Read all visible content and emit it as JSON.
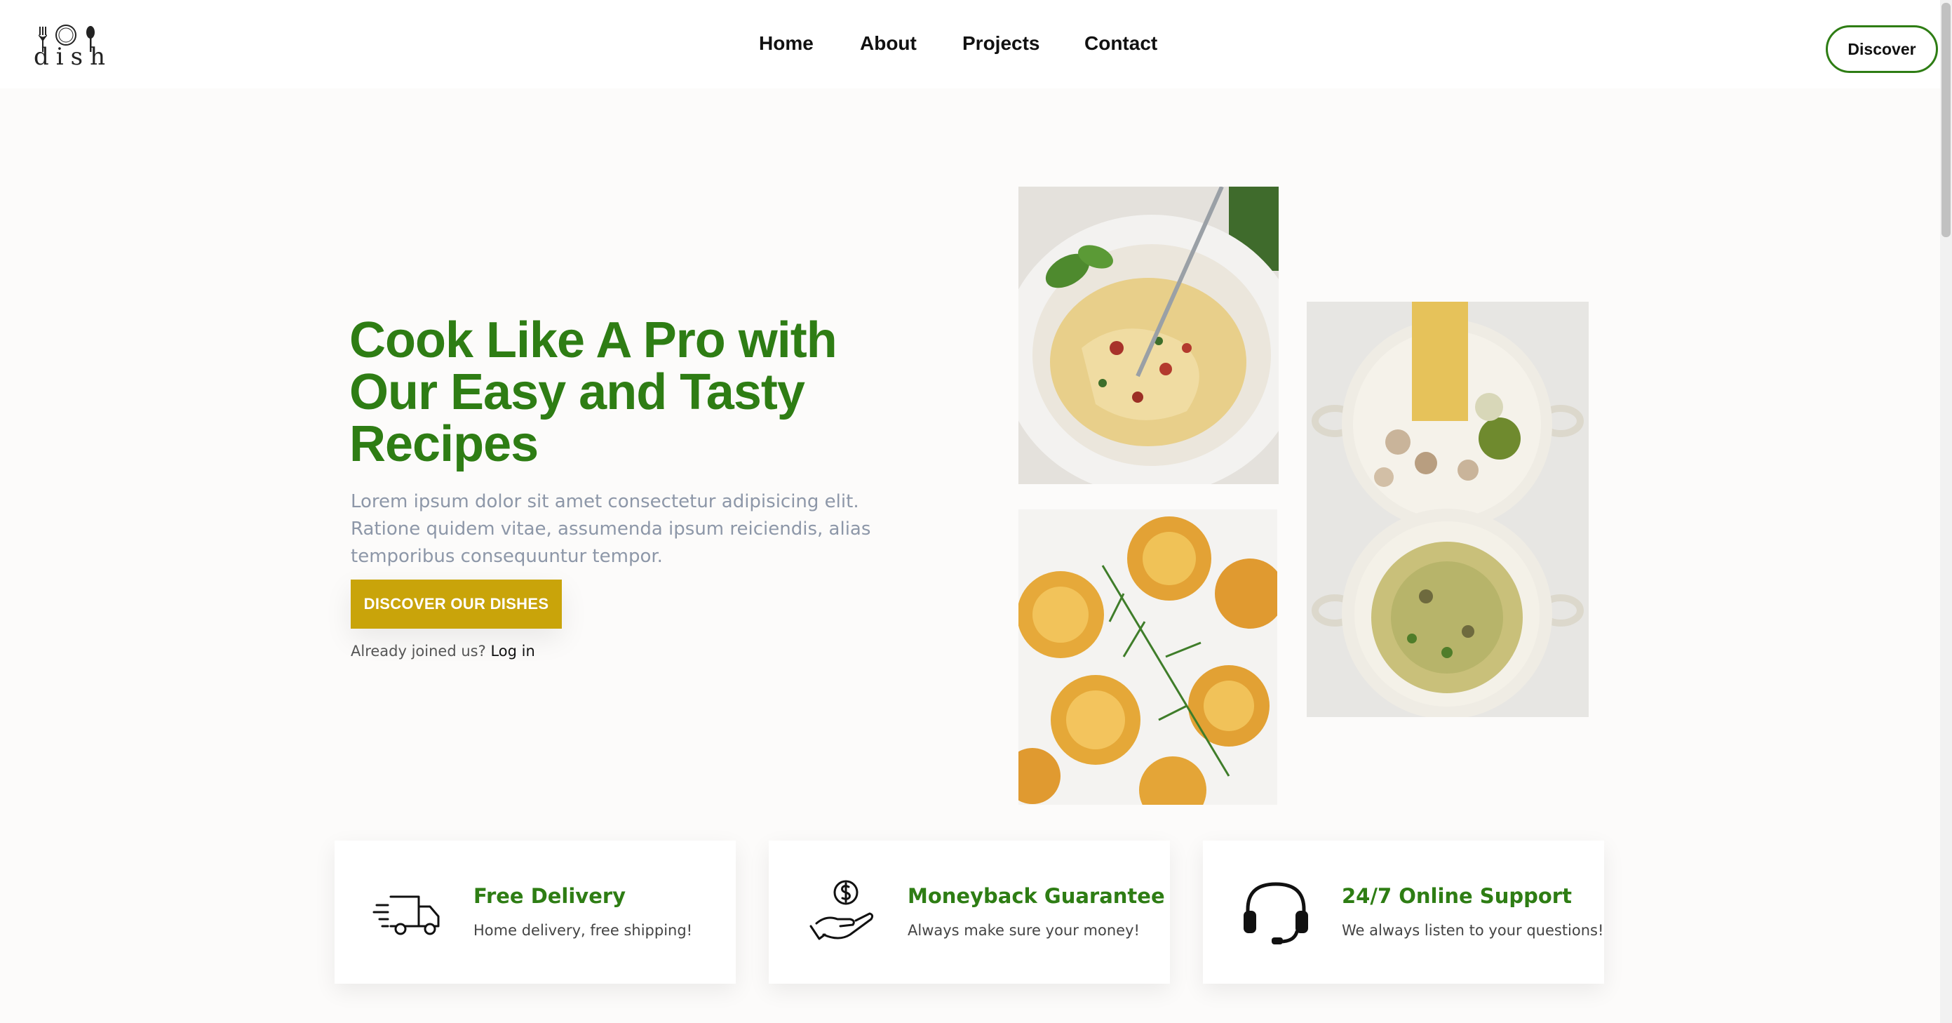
{
  "header": {
    "logo_text": "dish",
    "nav": [
      "Home",
      "About",
      "Projects",
      "Contact"
    ],
    "cta_label": "Discover"
  },
  "hero": {
    "title": "Cook Like A Pro with Our Easy and Tasty Recipes",
    "description": "Lorem ipsum dolor sit amet consectetur adipisicing elit. Ratione quidem vitae, assumenda ipsum reiciendis, alias temporibus consequuntur tempor.",
    "cta_label": "DISCOVER OUR DISHES",
    "joined_text": "Already joined us?",
    "login_label": "Log in"
  },
  "features": [
    {
      "icon": "delivery-truck-icon",
      "title": "Free Delivery",
      "subtitle": "Home delivery, free shipping!"
    },
    {
      "icon": "money-hand-icon",
      "title": "Moneyback Guarantee",
      "subtitle": "Always make sure your money!"
    },
    {
      "icon": "headset-icon",
      "title": "24/7 Online Support",
      "subtitle": "We always listen to your questions!"
    }
  ],
  "colors": {
    "accent_green": "#2e7d14",
    "cta_gold": "#c9a40a",
    "page_bg": "#fcfbfa",
    "muted_text": "#8d97a8"
  }
}
